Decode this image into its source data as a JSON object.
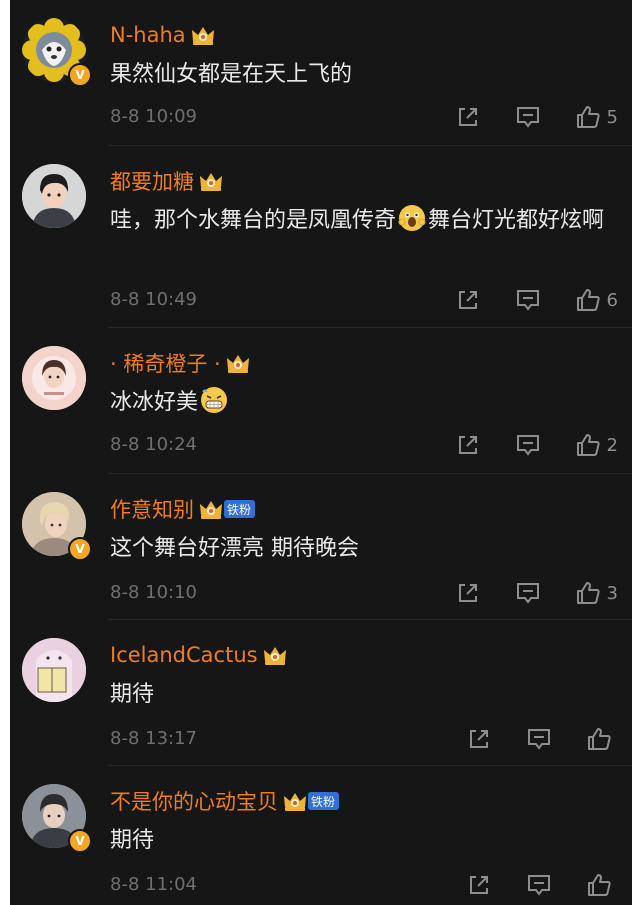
{
  "comments": [
    {
      "username": "N-haha",
      "text": "果然仙女都是在天上飞的",
      "emoji": "",
      "text_after": "",
      "time": "8-8 10:09",
      "likes": "5",
      "verified": true,
      "fan_badge": "",
      "avatar_color": "#d9b21f"
    },
    {
      "username": "都要加糖",
      "text": "哇，那个水舞台的是凤凰传奇",
      "emoji": "scream-face",
      "text_after": "舞台灯光都好炫啊",
      "time": "8-8 10:49",
      "likes": "6",
      "verified": false,
      "fan_badge": "",
      "avatar_color": "#c9c9c9"
    },
    {
      "username": "· 稀奇橙子 ·",
      "text": "冰冰好美",
      "emoji": "grimace-face",
      "text_after": "",
      "time": "8-8 10:24",
      "likes": "2",
      "verified": false,
      "fan_badge": "",
      "avatar_color": "#f2c9c4"
    },
    {
      "username": "作意知别",
      "text": "这个舞台好漂亮 期待晚会",
      "emoji": "",
      "text_after": "",
      "time": "8-8 10:10",
      "likes": "3",
      "verified": true,
      "fan_badge": "铁粉",
      "avatar_color": "#c7a886"
    },
    {
      "username": "IcelandCactus",
      "text": "期待",
      "emoji": "",
      "text_after": "",
      "time": "8-8 13:17",
      "likes": "",
      "verified": false,
      "fan_badge": "",
      "avatar_color": "#e7cde0"
    },
    {
      "username": "不是你的心动宝贝",
      "text": "期待",
      "emoji": "",
      "text_after": "",
      "time": "8-8 11:04",
      "likes": "",
      "verified": true,
      "fan_badge": "铁粉",
      "avatar_color": "#8a8e98"
    }
  ],
  "colors": {
    "background": "#161616",
    "username": "#ef7d1f",
    "text": "#e9e9e9",
    "meta": "#6f6f6f",
    "fan_badge": "#2f6fd6",
    "crown": "#f0b33a"
  }
}
